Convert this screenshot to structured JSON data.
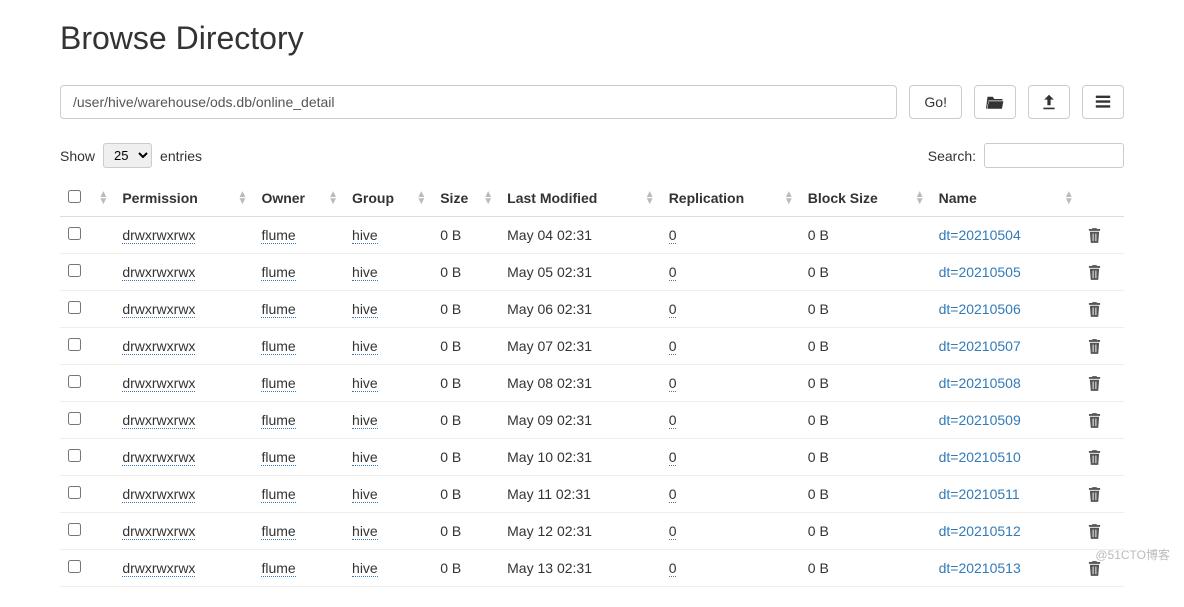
{
  "title": "Browse Directory",
  "path": "/user/hive/warehouse/ods.db/online_detail",
  "go_label": "Go!",
  "show_label_before": "Show",
  "show_label_after": "entries",
  "page_size": "25",
  "search_label": "Search:",
  "columns": {
    "permission": "Permission",
    "owner": "Owner",
    "group": "Group",
    "size": "Size",
    "last_modified": "Last Modified",
    "replication": "Replication",
    "block_size": "Block Size",
    "name": "Name"
  },
  "rows": [
    {
      "permission": "drwxrwxrwx",
      "owner": "flume",
      "group": "hive",
      "size": "0 B",
      "modified": "May 04 02:31",
      "replication": "0",
      "block": "0 B",
      "name": "dt=20210504"
    },
    {
      "permission": "drwxrwxrwx",
      "owner": "flume",
      "group": "hive",
      "size": "0 B",
      "modified": "May 05 02:31",
      "replication": "0",
      "block": "0 B",
      "name": "dt=20210505"
    },
    {
      "permission": "drwxrwxrwx",
      "owner": "flume",
      "group": "hive",
      "size": "0 B",
      "modified": "May 06 02:31",
      "replication": "0",
      "block": "0 B",
      "name": "dt=20210506"
    },
    {
      "permission": "drwxrwxrwx",
      "owner": "flume",
      "group": "hive",
      "size": "0 B",
      "modified": "May 07 02:31",
      "replication": "0",
      "block": "0 B",
      "name": "dt=20210507"
    },
    {
      "permission": "drwxrwxrwx",
      "owner": "flume",
      "group": "hive",
      "size": "0 B",
      "modified": "May 08 02:31",
      "replication": "0",
      "block": "0 B",
      "name": "dt=20210508"
    },
    {
      "permission": "drwxrwxrwx",
      "owner": "flume",
      "group": "hive",
      "size": "0 B",
      "modified": "May 09 02:31",
      "replication": "0",
      "block": "0 B",
      "name": "dt=20210509"
    },
    {
      "permission": "drwxrwxrwx",
      "owner": "flume",
      "group": "hive",
      "size": "0 B",
      "modified": "May 10 02:31",
      "replication": "0",
      "block": "0 B",
      "name": "dt=20210510"
    },
    {
      "permission": "drwxrwxrwx",
      "owner": "flume",
      "group": "hive",
      "size": "0 B",
      "modified": "May 11 02:31",
      "replication": "0",
      "block": "0 B",
      "name": "dt=20210511"
    },
    {
      "permission": "drwxrwxrwx",
      "owner": "flume",
      "group": "hive",
      "size": "0 B",
      "modified": "May 12 02:31",
      "replication": "0",
      "block": "0 B",
      "name": "dt=20210512"
    },
    {
      "permission": "drwxrwxrwx",
      "owner": "flume",
      "group": "hive",
      "size": "0 B",
      "modified": "May 13 02:31",
      "replication": "0",
      "block": "0 B",
      "name": "dt=20210513"
    }
  ],
  "watermark": "@51CTO博客"
}
